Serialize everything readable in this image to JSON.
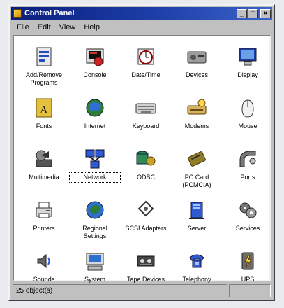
{
  "window": {
    "title": "Control Panel"
  },
  "menu": [
    "File",
    "Edit",
    "View",
    "Help"
  ],
  "items": [
    {
      "label": "Add/Remove Programs",
      "icon": "add-remove-programs-icon"
    },
    {
      "label": "Console",
      "icon": "console-icon"
    },
    {
      "label": "Date/Time",
      "icon": "date-time-icon"
    },
    {
      "label": "Devices",
      "icon": "devices-icon"
    },
    {
      "label": "Display",
      "icon": "display-icon"
    },
    {
      "label": "Fonts",
      "icon": "fonts-icon"
    },
    {
      "label": "Internet",
      "icon": "internet-icon"
    },
    {
      "label": "Keyboard",
      "icon": "keyboard-icon"
    },
    {
      "label": "Modems",
      "icon": "modems-icon"
    },
    {
      "label": "Mouse",
      "icon": "mouse-icon"
    },
    {
      "label": "Multimedia",
      "icon": "multimedia-icon"
    },
    {
      "label": "Network",
      "icon": "network-icon",
      "selected": true
    },
    {
      "label": "ODBC",
      "icon": "odbc-icon"
    },
    {
      "label": "PC Card (PCMCIA)",
      "icon": "pc-card-icon"
    },
    {
      "label": "Ports",
      "icon": "ports-icon"
    },
    {
      "label": "Printers",
      "icon": "printers-icon"
    },
    {
      "label": "Regional Settings",
      "icon": "regional-settings-icon"
    },
    {
      "label": "SCSI Adapters",
      "icon": "scsi-adapters-icon"
    },
    {
      "label": "Server",
      "icon": "server-icon"
    },
    {
      "label": "Services",
      "icon": "services-icon"
    },
    {
      "label": "Sounds",
      "icon": "sounds-icon"
    },
    {
      "label": "System",
      "icon": "system-icon"
    },
    {
      "label": "Tape Devices",
      "icon": "tape-devices-icon"
    },
    {
      "label": "Telephony",
      "icon": "telephony-icon"
    },
    {
      "label": "UPS",
      "icon": "ups-icon"
    }
  ],
  "status": {
    "count": "25 object(s)"
  }
}
